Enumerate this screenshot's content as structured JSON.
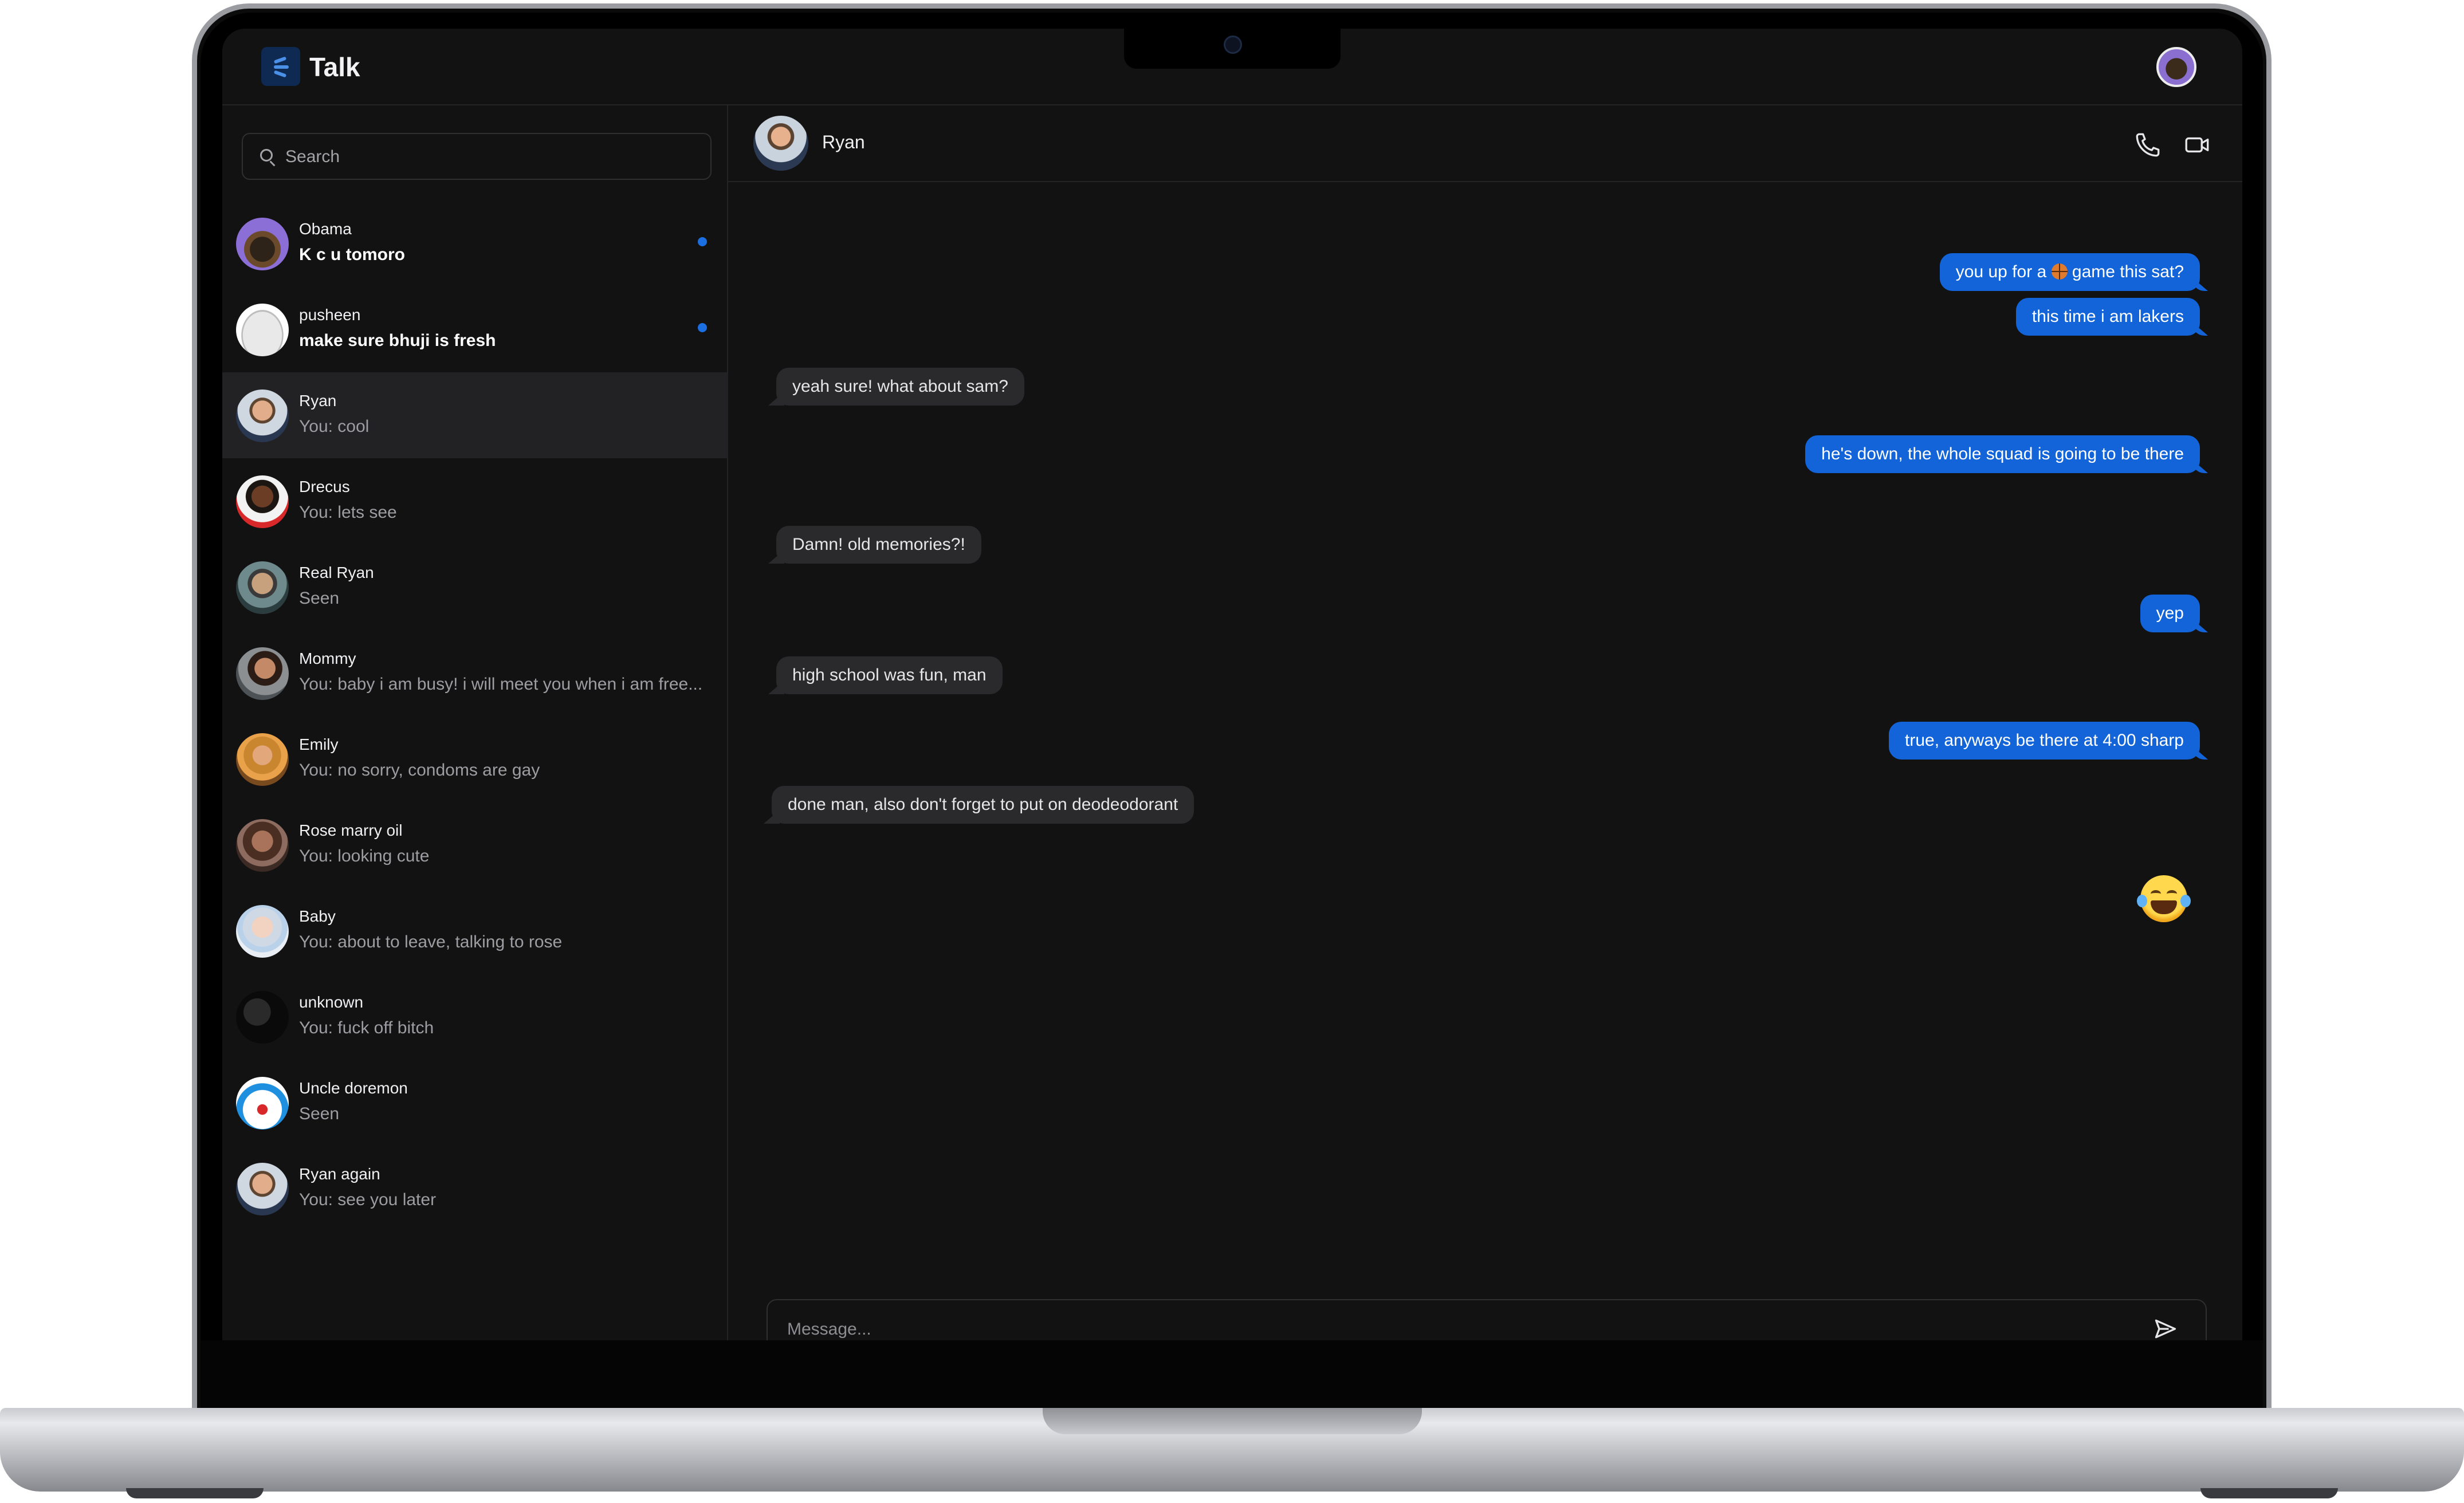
{
  "app": {
    "title": "Talk",
    "accent": "#1264d8"
  },
  "search": {
    "placeholder": "Search"
  },
  "conversations": [
    {
      "name": "Obama",
      "preview": "K c u tomoro",
      "unread": true,
      "avatar": "bored-ape-avatar"
    },
    {
      "name": "pusheen",
      "preview": "make sure bhuji is fresh",
      "unread": true,
      "avatar": "pusheen-cat-avatar"
    },
    {
      "name": "Ryan",
      "preview": "You: cool",
      "unread": false,
      "active": true,
      "avatar": "ryan-avatar"
    },
    {
      "name": "Drecus",
      "preview": "You: lets see",
      "unread": false,
      "avatar": "drecus-avatar"
    },
    {
      "name": "Real Ryan",
      "preview": "Seen",
      "unread": false,
      "avatar": "real-ryan-avatar"
    },
    {
      "name": "Mommy",
      "preview": "You: baby i am busy! i will meet you when i am free...",
      "unread": false,
      "avatar": "mommy-avatar"
    },
    {
      "name": "Emily",
      "preview": "You: no sorry, condoms are gay",
      "unread": false,
      "avatar": "emily-avatar"
    },
    {
      "name": "Rose marry oil",
      "preview": "You: looking cute",
      "unread": false,
      "avatar": "rose-avatar"
    },
    {
      "name": "Baby",
      "preview": "You: about to leave, talking to rose",
      "unread": false,
      "avatar": "baby-avatar"
    },
    {
      "name": "unknown",
      "preview": "You: fuck off bitch",
      "unread": false,
      "avatar": "unknown-avatar"
    },
    {
      "name": "Uncle doremon",
      "preview": "Seen",
      "unread": false,
      "avatar": "doraemon-avatar"
    },
    {
      "name": "Ryan again",
      "preview": "You: see you later",
      "unread": false,
      "avatar": "ryan-again-avatar"
    }
  ],
  "chat": {
    "contact_name": "Ryan",
    "messages": [
      {
        "from": "me",
        "text_before": "you up for a ",
        "emoji": "basketball",
        "text_after": " game this sat?"
      },
      {
        "from": "me",
        "text": "this time i am lakers"
      },
      {
        "from": "them",
        "text": "yeah sure! what about sam?"
      },
      {
        "from": "me",
        "text": "he's down, the whole squad is going to be there"
      },
      {
        "from": "them",
        "text": "Damn! old memories?!"
      },
      {
        "from": "me",
        "text": "yep"
      },
      {
        "from": "them",
        "text": "high school was fun, man"
      },
      {
        "from": "me",
        "text": "true, anyways be there at 4:00 sharp"
      },
      {
        "from": "them",
        "text": "done man, also don't forget to put on deodeodorant"
      },
      {
        "from": "me",
        "emoji": "face-with-tears-of-joy"
      }
    ],
    "composer_placeholder": "Message..."
  }
}
